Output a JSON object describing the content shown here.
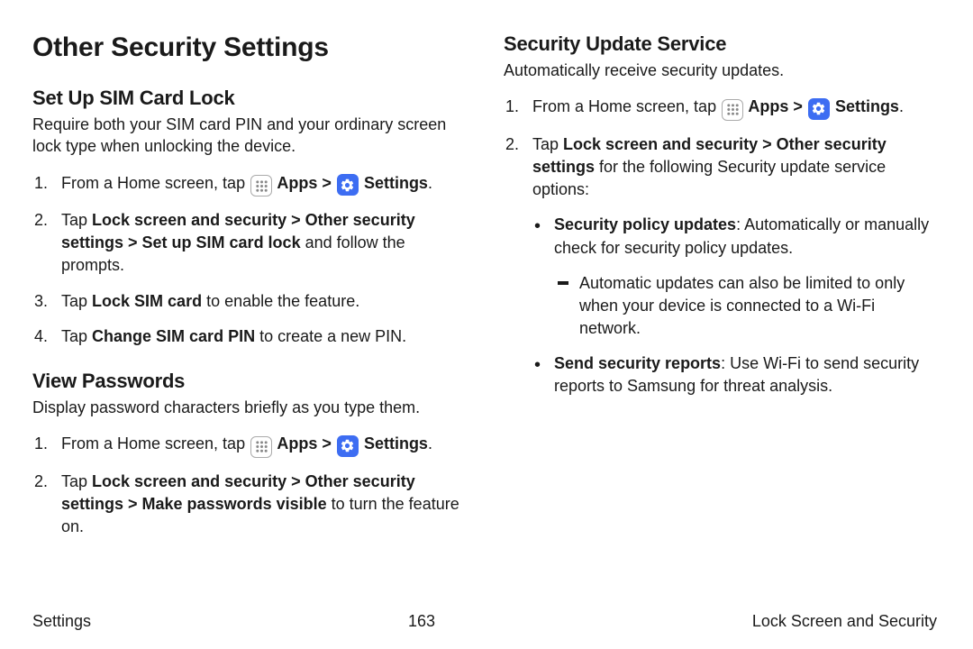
{
  "page": {
    "title": "Other Security Settings"
  },
  "left": {
    "sim": {
      "heading": "Set Up SIM Card Lock",
      "intro": "Require both your SIM card PIN and your ordinary screen lock type when unlocking the device.",
      "step1_a": "From a Home screen, tap ",
      "apps": " Apps",
      "sep": " > ",
      "settings": " Settings",
      "period": ".",
      "step2_a": "Tap ",
      "step2_b": "Lock screen and security",
      "step2_c": "Other security settings",
      "step2_d": "Set up SIM card lock",
      "step2_e": " and follow the prompts.",
      "step3_a": "Tap ",
      "step3_b": "Lock SIM card",
      "step3_c": " to enable the feature.",
      "step4_a": "Tap ",
      "step4_b": "Change SIM card PIN",
      "step4_c": " to create a new PIN."
    },
    "pw": {
      "heading": "View Passwords",
      "intro": "Display password characters briefly as you type them.",
      "step1_a": "From a Home screen, tap ",
      "apps": " Apps",
      "sep": " > ",
      "settings": " Settings",
      "period": ".",
      "step2_a": "Tap ",
      "step2_b": "Lock screen and security",
      "step2_c": "Other security settings",
      "step2_d": "Make passwords visible",
      "step2_e": " to turn the feature on."
    }
  },
  "right": {
    "sus": {
      "heading": "Security Update Service",
      "intro": "Automatically receive security updates.",
      "step1_a": "From a Home screen, tap ",
      "apps": " Apps",
      "sep": " > ",
      "settings": " Settings",
      "period": ".",
      "step2_a": "Tap ",
      "step2_b": "Lock screen and security",
      "step2_c": "Other security settings",
      "step2_d": " for the following Security update service options:",
      "bullet1_a": "Security policy updates",
      "bullet1_b": ": Automatically or manually check for security policy updates.",
      "dash1": "Automatic updates can also be limited to only when your device is connected to a Wi-Fi network.",
      "bullet2_a": "Send security reports",
      "bullet2_b": ": Use Wi-Fi to send security reports to Samsung for threat analysis."
    }
  },
  "footer": {
    "left": "Settings",
    "center": "163",
    "right": "Lock Screen and Security"
  }
}
